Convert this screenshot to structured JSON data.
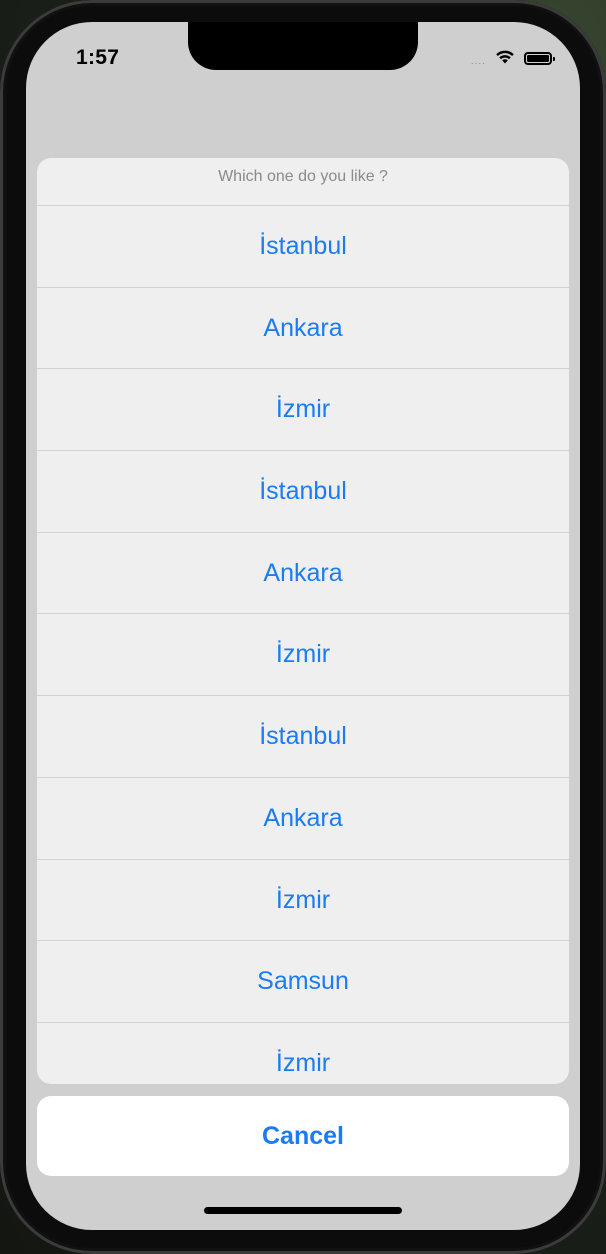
{
  "status_bar": {
    "time": "1:57",
    "signal": "....",
    "icons": [
      "wifi-icon",
      "battery-icon"
    ]
  },
  "action_sheet": {
    "title": "Which one do you like ?",
    "options": [
      "İstanbul",
      "Ankara",
      "İzmir",
      "İstanbul",
      "Ankara",
      "İzmir",
      "İstanbul",
      "Ankara",
      "İzmir",
      "Samsun",
      "İzmir"
    ],
    "cancel_label": "Cancel"
  },
  "colors": {
    "accent": "#1a7cf2",
    "sheet_background": "#efefef",
    "dimmed_background": "#cfcfcf",
    "title_gray": "#8a8a8f"
  }
}
